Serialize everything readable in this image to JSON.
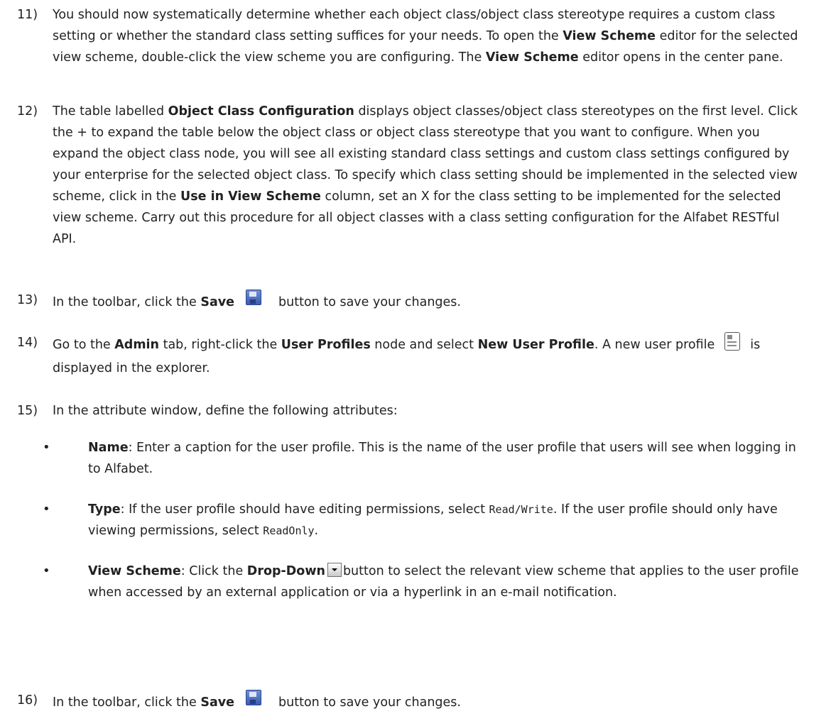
{
  "steps": [
    {
      "num": "11)",
      "t1": "You should now systematically determine whether each object class/object class stereotype requires a custom class setting or whether the standard class setting suffices for your needs. To open the ",
      "b1": "View Scheme",
      "t2": " editor for the selected view scheme, double-click the view scheme you are configuring. The ",
      "b2": "View Scheme",
      "t3": " editor opens in the center pane."
    },
    {
      "num": "12)",
      "t1": "The table labelled ",
      "b1": "Object Class Configuration",
      "t2": " displays object classes/object class stereotypes on the first level. Click the + to expand the table below the object class or object class stereotype that you want to configure. When you expand the object class node, you will see all existing standard class settings and custom class settings configured by your enterprise for the selected object class. To specify which class setting should be implemented in the selected view scheme, click in the ",
      "b2": "Use in View Scheme",
      "t3": " column, set an X for the class setting to be implemented for the selected view scheme. Carry out this procedure for all object classes with a class setting configuration for the Alfabet RESTful API."
    },
    {
      "num": "13)",
      "t1": "In the toolbar, click the ",
      "b1": "Save",
      "t2": "button to save your changes."
    },
    {
      "num": "14)",
      "t1": "Go to the ",
      "b1": "Admin",
      "t2": " tab, right-click the ",
      "b2": "User Profiles",
      "t3": " node and select ",
      "b3": "New User Profile",
      "t4": ". A new user profile",
      "t5": "is displayed in the explorer."
    },
    {
      "num": "15)",
      "t1": "In the attribute window, define the following attributes:"
    },
    {
      "num": "16)",
      "t1": "In the toolbar, click the ",
      "b1": "Save",
      "t2": "button to save your changes."
    }
  ],
  "bullets": [
    {
      "b1": "Name",
      "t1": ": Enter a caption for the user profile. This is the name of the user profile that users will see when logging in to Alfabet."
    },
    {
      "b1": "Type",
      "t1": ": If the user profile should have editing permissions, select ",
      "c1": "Read/Write",
      "t2": ". If the user profile should only have viewing permissions, select ",
      "c2": "ReadOnly",
      "t3": "."
    },
    {
      "b1": "View Scheme",
      "t1": ": Click the ",
      "b2": "Drop-Down",
      "t2": "button to select the relevant view scheme that applies to the user profile when accessed by an external application or via a hyperlink in an e-mail notification."
    }
  ],
  "icons": {
    "save": "floppy-disk-save-icon",
    "profile": "user-profile-card-icon",
    "dropdown": "dropdown-arrow-icon"
  }
}
